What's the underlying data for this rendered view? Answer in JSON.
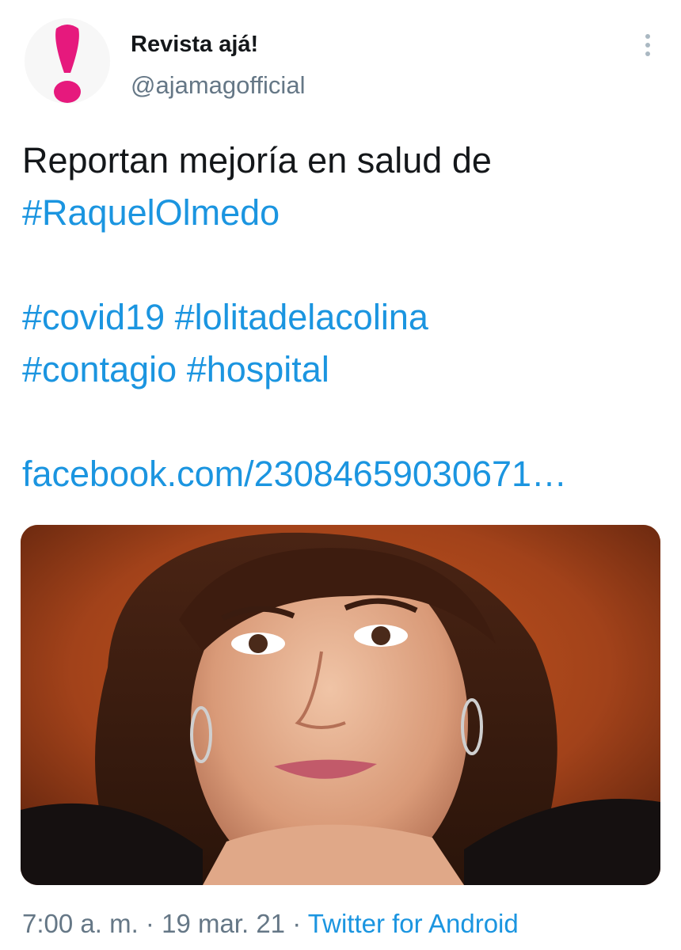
{
  "profile": {
    "display_name": "Revista ajá!",
    "handle": "@ajamagofficial",
    "avatar_icon": "exclamation-logo-icon",
    "avatar_color": "#e6197d"
  },
  "menu": {
    "icon": "more-vertical-icon"
  },
  "tweet": {
    "text_line1": "Reportan mejoría en salud de",
    "hashtag_raquel": "#RaquelOlmedo",
    "hashtag_covid": "#covid19",
    "hashtag_lolita": "#lolitadelacolina",
    "hashtag_contagio": "#contagio",
    "hashtag_hospital": "#hospital",
    "link": "facebook.com/23084659030671…"
  },
  "media": {
    "subject": "portrait-photo"
  },
  "meta": {
    "time": "7:00 a. m.",
    "date": "19 mar. 21",
    "separator": "·",
    "source": "Twitter for Android"
  },
  "colors": {
    "link": "#1b95e0",
    "text": "#14171a",
    "secondary": "#657786",
    "brand": "#e6197d"
  }
}
